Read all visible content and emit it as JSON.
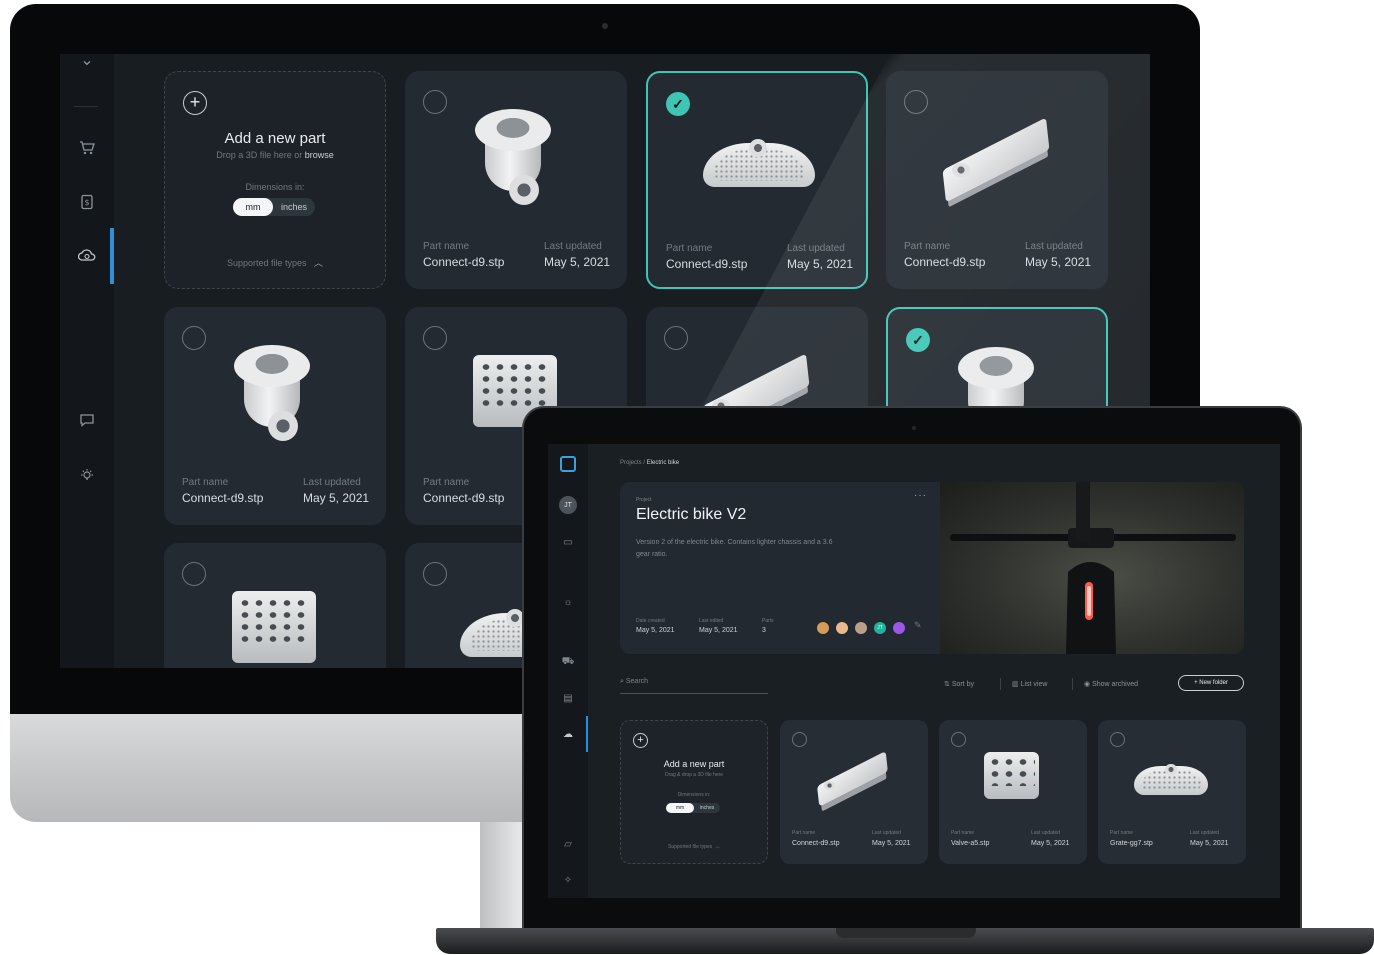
{
  "desktop": {
    "add_part": {
      "title": "Add a new part",
      "drop_text": "Drop a 3D file here or",
      "browse": "browse",
      "dimensions_label": "Dimensions in:",
      "unit_mm": "mm",
      "unit_inches": "inches",
      "supported": "Supported file types"
    },
    "part_name_label": "Part name",
    "last_updated_label": "Last updated",
    "cards": [
      {
        "name": "Connect-d9.stp",
        "date": "May 5, 2021",
        "selected": false,
        "shape": "clamp"
      },
      {
        "name": "Connect-d9.stp",
        "date": "May 5, 2021",
        "selected": true,
        "shape": "tray"
      },
      {
        "name": "Connect-d9.stp",
        "date": "May 5, 2021",
        "selected": false,
        "shape": "plate"
      },
      {
        "name": "Connect-d9.stp",
        "date": "May 5, 2021",
        "selected": false,
        "shape": "clamp"
      },
      {
        "name": "Connect-d9.stp",
        "date": "",
        "selected": false,
        "shape": "connector"
      },
      {
        "name": "",
        "date": "",
        "selected": false,
        "shape": "plate"
      },
      {
        "name": "",
        "date": "",
        "selected": true,
        "shape": "clamp"
      },
      {
        "name": "",
        "date": "",
        "selected": false,
        "shape": "connector"
      },
      {
        "name": "",
        "date": "",
        "selected": false,
        "shape": "tray"
      }
    ],
    "rail_icons": [
      "chevron-down-icon",
      "cart-icon",
      "invoice-icon",
      "cloud-part-icon",
      "chat-icon",
      "lightbulb-icon"
    ],
    "accent": "#3fc5b4",
    "nav_accent": "#2f8ed8"
  },
  "laptop": {
    "breadcrumb": {
      "root": "Projects",
      "separator": "/",
      "current": "Electric bike"
    },
    "project": {
      "overline": "Project",
      "title": "Electric bike V2",
      "description": "Version 2 of the electric bike. Contains lighter chassis and a 3.6 gear ratio.",
      "menu": "···",
      "date_created_label": "Date created",
      "date_created": "May 5, 2021",
      "last_edited_label": "Last edited",
      "last_edited": "May 5, 2021",
      "parts_label": "Parts",
      "parts": "3",
      "avatars": [
        {
          "initials": "",
          "color": "#d69a5a"
        },
        {
          "initials": "",
          "color": "#e8b98f"
        },
        {
          "initials": "",
          "color": "#b9a08a"
        },
        {
          "initials": "JT",
          "color": "#22b3a0"
        },
        {
          "initials": "",
          "color": "#9b57e6"
        }
      ]
    },
    "rail": {
      "avatar_initials": "JT"
    },
    "toolbar": {
      "search_placeholder": "Search",
      "sort": "Sort by",
      "list_view": "List view",
      "show_archived": "Show archived",
      "new_folder": "+ New folder"
    },
    "add_part": {
      "title": "Add a new part",
      "drop_text": "Drag & drop a 3D file here",
      "dimensions_label": "Dimensions in:",
      "unit_mm": "mm",
      "unit_inches": "inches",
      "supported": "Supported file types"
    },
    "part_name_label": "Part name",
    "last_updated_label": "Last updated",
    "cards": [
      {
        "name": "Connect-d9.stp",
        "date": "May 5, 2021",
        "shape": "plate"
      },
      {
        "name": "Valve-a5.stp",
        "date": "May 5, 2021",
        "shape": "connector"
      },
      {
        "name": "Grate-gg7.stp",
        "date": "May 5, 2021",
        "shape": "tray"
      }
    ]
  }
}
